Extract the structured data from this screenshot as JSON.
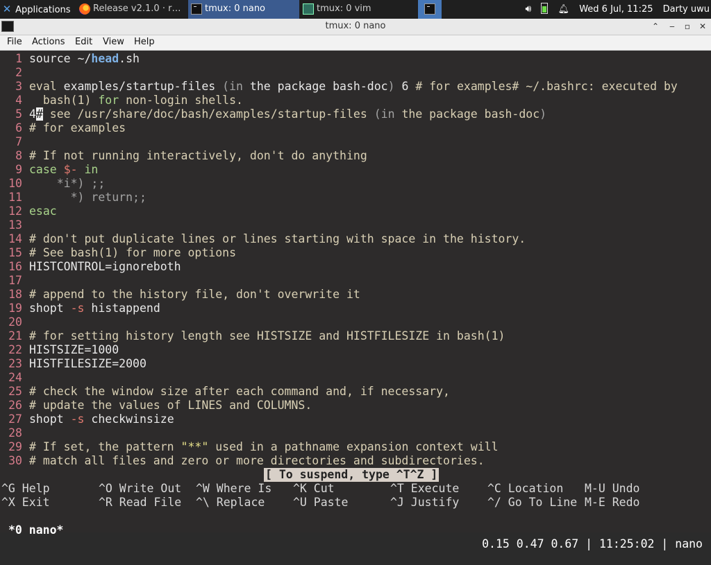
{
  "panel": {
    "apps_label": "Applications",
    "tasks": [
      {
        "label": "Release v2.1.0 · r…",
        "icon": "firefox-icon"
      },
      {
        "label": "tmux: 0 nano",
        "icon": "terminal-icon"
      },
      {
        "label": "tmux: 0 vim",
        "icon": "vim-icon"
      }
    ],
    "datetime": "Wed  6 Jul, 11:25",
    "user": "Darty uwu"
  },
  "window": {
    "title": "tmux: 0 nano"
  },
  "menubar": {
    "file": "File",
    "actions": "Actions",
    "edit": "Edit",
    "view": "View",
    "help": "Help"
  },
  "editor": {
    "lines": [
      {
        "n": "1",
        "segs": [
          {
            "t": "source ~/",
            "c": ""
          },
          {
            "t": "head",
            "c": "bl"
          },
          {
            "t": ".sh",
            "c": ""
          }
        ]
      },
      {
        "n": "2",
        "segs": []
      },
      {
        "n": "3",
        "segs": [
          {
            "t": "eval",
            "c": "cm"
          },
          {
            "t": " examples/startup-files ",
            "c": ""
          },
          {
            "t": "(in",
            "c": "gray"
          },
          {
            "t": " the package bash-doc",
            "c": ""
          },
          {
            "t": ")",
            "c": "gray"
          },
          {
            "t": " 6 ",
            "c": ""
          },
          {
            "t": "# for examples# ~/.bashrc: executed by",
            "c": "cm"
          }
        ]
      },
      {
        "n": "4",
        "segs": [
          {
            "t": "  bash(1) ",
            "c": "cm"
          },
          {
            "t": "for",
            "c": "kw"
          },
          {
            "t": " non-login shells.",
            "c": "cm"
          }
        ]
      },
      {
        "n": "5",
        "segs": [
          {
            "t": "4",
            "c": ""
          },
          {
            "t": "#",
            "c": "cur"
          },
          {
            "t": " see /usr/share/doc/bash/examples/startup-files ",
            "c": "cm"
          },
          {
            "t": "(in",
            "c": "gray"
          },
          {
            "t": " the package bash-doc",
            "c": "cm"
          },
          {
            "t": ")",
            "c": "gray"
          }
        ]
      },
      {
        "n": "6",
        "segs": [
          {
            "t": "# for examples",
            "c": "cm"
          }
        ]
      },
      {
        "n": "7",
        "segs": []
      },
      {
        "n": "8",
        "segs": [
          {
            "t": "# If not running interactively, don't do anything",
            "c": "cm"
          }
        ]
      },
      {
        "n": "9",
        "segs": [
          {
            "t": "case",
            "c": "kw"
          },
          {
            "t": " ",
            "c": ""
          },
          {
            "t": "$-",
            "c": "rd"
          },
          {
            "t": " in",
            "c": "kw"
          }
        ]
      },
      {
        "n": "10",
        "segs": [
          {
            "t": "    *i*) ;;",
            "c": "gray"
          }
        ]
      },
      {
        "n": "11",
        "segs": [
          {
            "t": "      *) return;;",
            "c": "gray"
          }
        ]
      },
      {
        "n": "12",
        "segs": [
          {
            "t": "esac",
            "c": "kw"
          }
        ]
      },
      {
        "n": "13",
        "segs": []
      },
      {
        "n": "14",
        "segs": [
          {
            "t": "# don't put duplicate lines or lines starting with space in the history.",
            "c": "cm"
          }
        ]
      },
      {
        "n": "15",
        "segs": [
          {
            "t": "# See bash(1) for more options",
            "c": "cm"
          }
        ]
      },
      {
        "n": "16",
        "segs": [
          {
            "t": "HISTCONTROL=ignoreboth",
            "c": ""
          }
        ]
      },
      {
        "n": "17",
        "segs": []
      },
      {
        "n": "18",
        "segs": [
          {
            "t": "# append to the history file, don't overwrite it",
            "c": "cm"
          }
        ]
      },
      {
        "n": "19",
        "segs": [
          {
            "t": "shopt ",
            "c": ""
          },
          {
            "t": "-s",
            "c": "rd"
          },
          {
            "t": " histappend",
            "c": ""
          }
        ]
      },
      {
        "n": "20",
        "segs": []
      },
      {
        "n": "21",
        "segs": [
          {
            "t": "# for setting history length see HISTSIZE and HISTFILESIZE in bash(1)",
            "c": "cm"
          }
        ]
      },
      {
        "n": "22",
        "segs": [
          {
            "t": "HISTSIZE=1000",
            "c": ""
          }
        ]
      },
      {
        "n": "23",
        "segs": [
          {
            "t": "HISTFILESIZE=2000",
            "c": ""
          }
        ]
      },
      {
        "n": "24",
        "segs": []
      },
      {
        "n": "25",
        "segs": [
          {
            "t": "# check the window size after each command and, if necessary,",
            "c": "cm"
          }
        ]
      },
      {
        "n": "26",
        "segs": [
          {
            "t": "# update the values of LINES and COLUMNS.",
            "c": "cm"
          }
        ]
      },
      {
        "n": "27",
        "segs": [
          {
            "t": "shopt ",
            "c": ""
          },
          {
            "t": "-s",
            "c": "rd"
          },
          {
            "t": " checkwinsize",
            "c": ""
          }
        ]
      },
      {
        "n": "28",
        "segs": []
      },
      {
        "n": "29",
        "segs": [
          {
            "t": "# If set, the pattern ",
            "c": "cm"
          },
          {
            "t": "\"**\"",
            "c": "ye"
          },
          {
            "t": " used in a pathname expansion context will",
            "c": "cm"
          }
        ]
      },
      {
        "n": "30",
        "segs": [
          {
            "t": "# match all files and zero or more directories and subdirectories.",
            "c": "cm"
          }
        ]
      }
    ],
    "status_message": "[ To suspend, type ^T^Z ]",
    "shortcuts_row1": [
      {
        "key": "^G",
        "label": " Help"
      },
      {
        "key": "^O",
        "label": " Write Out"
      },
      {
        "key": "^W",
        "label": " Where Is"
      },
      {
        "key": "^K",
        "label": " Cut"
      },
      {
        "key": "^T",
        "label": " Execute"
      },
      {
        "key": "^C",
        "label": " Location"
      },
      {
        "key": "M-U",
        "label": " Undo"
      }
    ],
    "shortcuts_row2": [
      {
        "key": "^X",
        "label": " Exit"
      },
      {
        "key": "^R",
        "label": " Read File"
      },
      {
        "key": "^\\",
        "label": " Replace"
      },
      {
        "key": "^U",
        "label": " Paste"
      },
      {
        "key": "^J",
        "label": " Justify"
      },
      {
        "key": "^/",
        "label": " Go To Line"
      },
      {
        "key": "M-E",
        "label": " Redo"
      }
    ]
  },
  "tmux": {
    "window": "*0 nano*",
    "status": "0.15 0.47 0.67 | 11:25:02 | nano"
  }
}
